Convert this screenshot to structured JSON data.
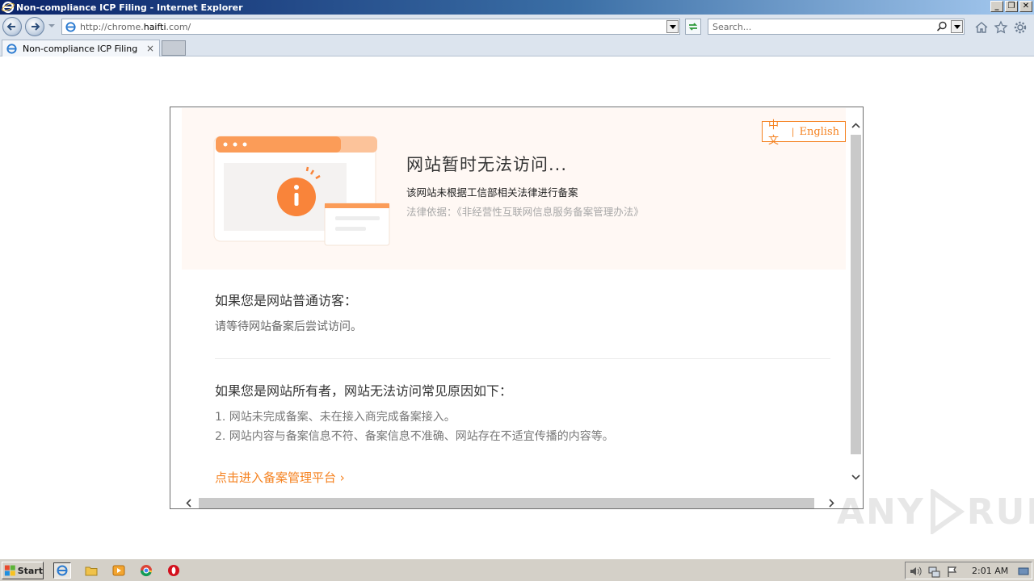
{
  "window": {
    "title": "Non-compliance ICP Filing - Internet Explorer",
    "buttons": [
      "_",
      "❐",
      "✕"
    ]
  },
  "navbar": {
    "url_prefix": "http://chrome.",
    "url_domain": "haifti",
    "url_suffix": ".com/",
    "search_placeholder": "Search..."
  },
  "tab": {
    "label": "Non-compliance ICP Filing",
    "close": "×"
  },
  "page": {
    "lang_zh": "中文",
    "lang_sep": "|",
    "lang_en": "English",
    "hero_title": "网站暂时无法访问...",
    "hero_desc": "该网站未根据工信部相关法律进行备案",
    "hero_law": "法律依据：《非经营性互联网信息服务备案管理办法》",
    "visitor_title": "如果您是网站普通访客：",
    "visitor_text": "请等待网站备案后尝试访问。",
    "owner_title": "如果您是网站所有者，网站无法访问常见原因如下：",
    "reasons": [
      "1. 网站未完成备案、未在接入商完成备案接入。",
      "2. 网站内容与备案信息不符、备案信息不准确、网站存在不适宜传播的内容等。"
    ],
    "link": "点击进入备案管理平台 ›"
  },
  "watermark": {
    "left": "ANY",
    "right": "RUN"
  },
  "taskbar": {
    "start": "Start",
    "clock": "2:01 AM"
  },
  "colors": {
    "accent": "#f58220",
    "hero_bg": "#fff8f4"
  }
}
